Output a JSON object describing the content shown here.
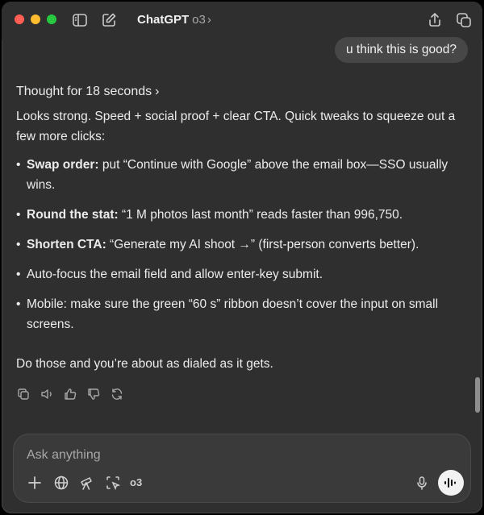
{
  "header": {
    "app_name": "ChatGPT",
    "model": "o3",
    "chevron": "›"
  },
  "conversation": {
    "user_message": "u think this is good?",
    "thought_label": "Thought for 18 seconds",
    "thought_arrow": "›",
    "intro": "Looks strong. Speed + social proof + clear CTA. Quick tweaks to squeeze out a few more clicks:",
    "bullets": [
      {
        "bold": "Swap order:",
        "text": " put “Continue with Google” above the email box—SSO usually wins."
      },
      {
        "bold": "Round the stat:",
        "text": " “1 M photos last month” reads faster than 996,750."
      },
      {
        "bold": "Shorten CTA:",
        "text": " “Generate my AI shoot →” (first-person converts better)."
      },
      {
        "bold": "",
        "text": "Auto-focus the email field and allow enter-key submit."
      },
      {
        "bold": "",
        "text": "Mobile: make sure the green “60 s” ribbon doesn’t cover the input on small screens."
      }
    ],
    "closing": "Do those and you’re about as dialed as it gets."
  },
  "message_actions": [
    "copy-icon",
    "read-aloud-icon",
    "thumbs-up-icon",
    "thumbs-down-icon",
    "regenerate-icon"
  ],
  "composer": {
    "placeholder": "Ask anything",
    "value": "",
    "model_badge": "o3",
    "tools": [
      "plus-icon",
      "globe-icon",
      "telescope-icon",
      "screenshot-select-icon"
    ]
  },
  "colors": {
    "background": "#2f2f2f",
    "bubble": "#474747",
    "composer": "#3a3a3a",
    "text": "#ececec",
    "muted": "#a8a8a8",
    "traffic_red": "#ff5f57",
    "traffic_yellow": "#febc2e",
    "traffic_green": "#28c840"
  }
}
